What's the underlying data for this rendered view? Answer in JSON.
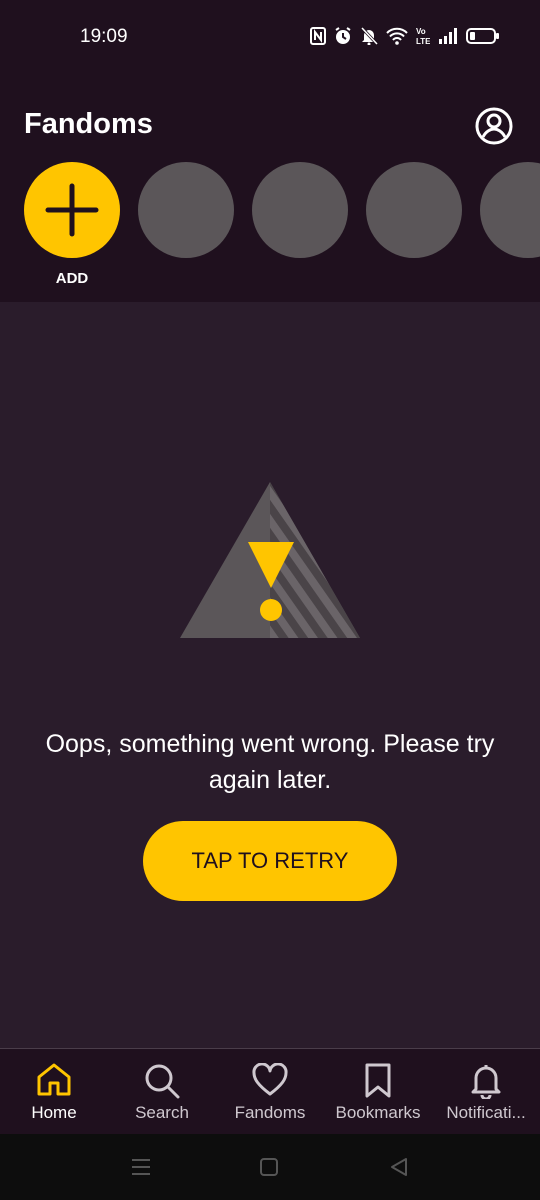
{
  "status_bar": {
    "time": "19:09",
    "icons": [
      "nfc-icon",
      "alarm-icon",
      "mute-icon",
      "wifi-icon",
      "volte-icon",
      "signal-icon",
      "battery-icon"
    ]
  },
  "header": {
    "title": "Fandoms",
    "profile_icon": "profile-icon"
  },
  "fandom_row": {
    "add_label": "ADD",
    "placeholder_count": 4
  },
  "error": {
    "message": "Oops, something went wrong. Please try again later.",
    "retry_label": "TAP TO RETRY"
  },
  "bottom_nav": {
    "items": [
      {
        "label": "Home",
        "icon": "home-icon",
        "active": true
      },
      {
        "label": "Search",
        "icon": "search-icon",
        "active": false
      },
      {
        "label": "Fandoms",
        "icon": "heart-icon",
        "active": false
      },
      {
        "label": "Bookmarks",
        "icon": "bookmark-icon",
        "active": false
      },
      {
        "label": "Notificati...",
        "icon": "bell-icon",
        "active": false
      }
    ]
  },
  "colors": {
    "accent": "#ffc500",
    "background": "#2a1c2b",
    "header_bg": "#1f101e",
    "placeholder": "#5b5659"
  }
}
